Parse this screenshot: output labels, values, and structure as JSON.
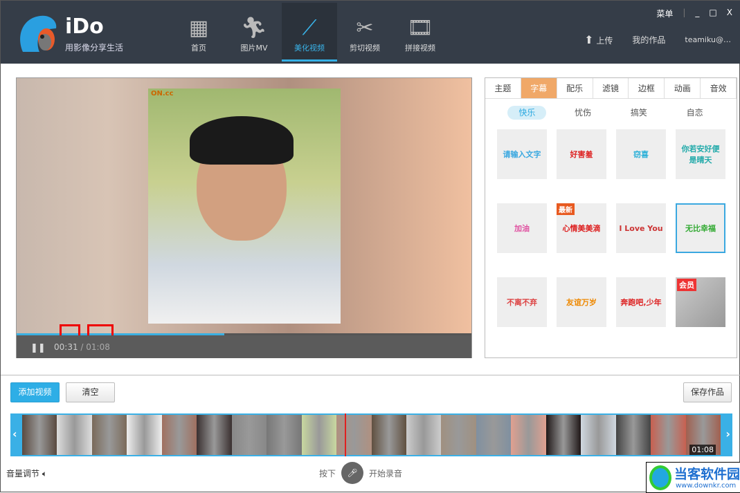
{
  "app": {
    "name": "iDo",
    "slogan": "用影像分享生活"
  },
  "nav": [
    {
      "label": "首页",
      "icon": "grid-icon"
    },
    {
      "label": "图片MV",
      "icon": "dancer-icon"
    },
    {
      "label": "美化视频",
      "icon": "magic-wand-icon",
      "active": true
    },
    {
      "label": "剪切视频",
      "icon": "scissors-icon"
    },
    {
      "label": "拼接视频",
      "icon": "film-icon"
    }
  ],
  "window": {
    "menu": "菜单",
    "minimize": "_",
    "maximize": "□",
    "close": "X"
  },
  "topright": {
    "upload": "上传",
    "my_works": "我的作品",
    "user": "teamiku@…"
  },
  "player": {
    "watermark": "ON.cc",
    "current": "00:31",
    "separator": " / ",
    "total": "01:08",
    "progress": 0.456
  },
  "panel": {
    "tabs": [
      "主题",
      "字幕",
      "配乐",
      "滤镜",
      "边框",
      "动画",
      "音效"
    ],
    "active_tab": 1,
    "categories": [
      "快乐",
      "忧伤",
      "搞笑",
      "自恋"
    ],
    "stickers": [
      {
        "text": "请输入文字",
        "color": "#3aa8e0"
      },
      {
        "text": "好害羞",
        "color": "#d22"
      },
      {
        "text": "窃喜",
        "color": "#2bb0d8"
      },
      {
        "text": "你若安好便是晴天",
        "color": "#2aa"
      },
      {
        "text": "加油",
        "color": "#e050a0"
      },
      {
        "text": "心情美美滴",
        "color": "#d22",
        "badge": "最新"
      },
      {
        "text": "I Love You",
        "color": "#c33"
      },
      {
        "text": "无比幸福",
        "color": "#3a3",
        "selected": true
      },
      {
        "text": "不离不弃",
        "color": "#d44"
      },
      {
        "text": "友谊万岁",
        "color": "#e80"
      },
      {
        "text": "奔跑吧,少年",
        "color": "#d22"
      },
      {
        "text": "会员",
        "color": "#fff",
        "badge": "会员"
      }
    ]
  },
  "buttons": {
    "add": "添加视频",
    "clear": "清空",
    "save": "保存作品"
  },
  "timeline": {
    "duration": "01:08",
    "prev": "‹",
    "next": "›"
  },
  "bottom": {
    "volume": "音量调节",
    "press": "按下",
    "record": "开始录音"
  },
  "watermark": {
    "name": "当客软件园",
    "url": "www.downkr.com"
  }
}
